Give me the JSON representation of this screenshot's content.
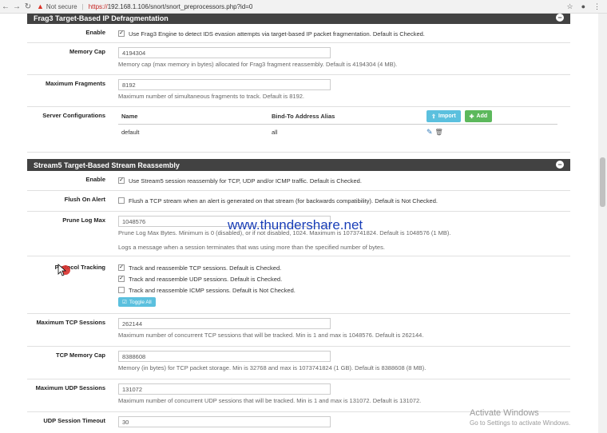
{
  "browser": {
    "not_secure": "Not secure",
    "url_https": "https://",
    "url_rest": "192.168.1.106/snort/snort_preprocessors.php?id=0"
  },
  "frag3": {
    "title": "Frag3 Target-Based IP Defragmentation",
    "enable_label": "Enable",
    "enable_text": "Use Frag3 Engine to detect IDS evasion attempts via target-based IP packet fragmentation. Default is Checked.",
    "enable_checked": true,
    "memcap_label": "Memory Cap",
    "memcap_value": "4194304",
    "memcap_help": "Memory cap (max memory in bytes) allocated for Frag3 fragment reassembly. Default is 4194304 (4 MB).",
    "maxfrag_label": "Maximum Fragments",
    "maxfrag_value": "8192",
    "maxfrag_help": "Maximum number of simultaneous fragments to track. Default is 8192.",
    "server_label": "Server Configurations",
    "col_name": "Name",
    "col_bind": "Bind-To Address Alias",
    "import_label": "Import",
    "add_label": "Add",
    "server_rows": [
      {
        "name": "default",
        "bind": "all"
      }
    ]
  },
  "stream5": {
    "title": "Stream5 Target-Based Stream Reassembly",
    "enable_label": "Enable",
    "enable_text": "Use Stream5 session reassembly for TCP, UDP and/or ICMP traffic. Default is Checked.",
    "flush_label": "Flush On Alert",
    "flush_text": "Flush a TCP stream when an alert is generated on that stream (for backwards compatibility). Default is Not Checked.",
    "prunelog_label": "Prune Log Max",
    "prunelog_value": "1048576",
    "prunelog_help1": "Prune Log Max Bytes. Minimum is 0 (disabled), or if not disabled, 1024. Maximum is 1073741824. Default is 1048576 (1 MB).",
    "prunelog_help2": "Logs a message when a session terminates that was using more than the specified number of bytes.",
    "proto_label": "Protocol Tracking",
    "proto_tcp": "Track and reassemble TCP sessions. Default is Checked.",
    "proto_udp": "Track and reassemble UDP sessions. Default is Checked.",
    "proto_icmp": "Track and reassemble ICMP sessions. Default is Not Checked.",
    "toggle_all": "Toggle All",
    "maxtcp_label": "Maximum TCP Sessions",
    "maxtcp_value": "262144",
    "maxtcp_help": "Maximum number of concurrent TCP sessions that will be tracked. Min is 1 and max is 1048576. Default is 262144.",
    "tcpmem_label": "TCP Memory Cap",
    "tcpmem_value": "8388608",
    "tcpmem_help": "Memory (in bytes) for TCP packet storage. Min is 32768 and max is 1073741824 (1 GB). Default is 8388608 (8 MB).",
    "maxudp_label": "Maximum UDP Sessions",
    "maxudp_value": "131072",
    "maxudp_help": "Maximum number of concurrent UDP sessions that will be tracked. Min is 1 and max is 131072. Default is 131072.",
    "udptimeout_label": "UDP Session Timeout",
    "udptimeout_value": "30"
  },
  "watermark": "www.thundershare.net",
  "windows": {
    "activate": "Activate Windows",
    "goto": "Go to Settings to activate Windows."
  }
}
